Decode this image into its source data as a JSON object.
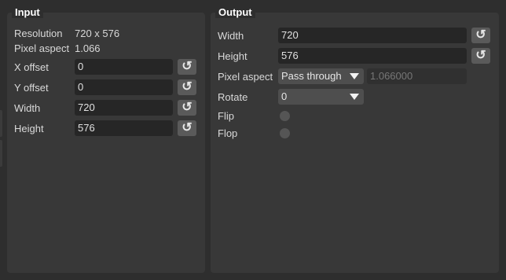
{
  "input": {
    "title": "Input",
    "resolution_label": "Resolution",
    "resolution_value": "720 x 576",
    "pixel_aspect_label": "Pixel aspect",
    "pixel_aspect_value": "1.066",
    "fields": [
      {
        "label": "X offset",
        "value": "0"
      },
      {
        "label": "Y offset",
        "value": "0"
      },
      {
        "label": "Width",
        "value": "720"
      },
      {
        "label": "Height",
        "value": "576"
      }
    ],
    "reset_glyph": "↺"
  },
  "output": {
    "title": "Output",
    "width_label": "Width",
    "width_value": "720",
    "height_label": "Height",
    "height_value": "576",
    "pixel_aspect_label": "Pixel aspect",
    "pixel_aspect_mode": "Pass through",
    "pixel_aspect_value": "1.066000",
    "rotate_label": "Rotate",
    "rotate_value": "0",
    "flip_label": "Flip",
    "flop_label": "Flop",
    "flip_on": false,
    "flop_on": false
  },
  "icons": {
    "reset": "reset-icon",
    "dropdown": "chevron-down-icon",
    "toggle": "toggle-off-icon"
  }
}
